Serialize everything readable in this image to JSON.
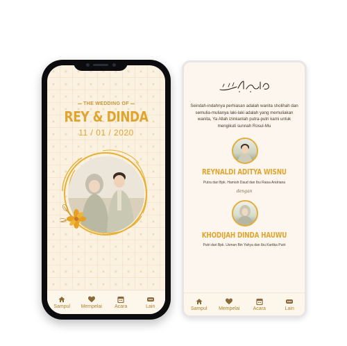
{
  "cover": {
    "subtitle": "THE WEDDING OF",
    "couple": "REY & DINDA",
    "date": "11 / 01 / 2020"
  },
  "nav_left": [
    {
      "label": "Sampul",
      "icon": "home-icon"
    },
    {
      "label": "Mempelai",
      "icon": "heart-icon"
    },
    {
      "label": "Acara",
      "icon": "calendar-icon"
    },
    {
      "label": "Lain",
      "icon": "more-icon"
    }
  ],
  "couple_page": {
    "quote": "Seindah-indahnya perhiasan adalah wanita sholihah dan semulia-mulianya laki-laki adalah yang memuliakan wanita, Ya Allah izinkanlah putra-putri kami untuk mengikuti sunnah Rosul-Mu",
    "groom_name": "REYNALDI ADITYA WISNU",
    "groom_parents": "Putra dari Bpk. Hamish Daud dan Ibu Raisa Andriana",
    "connector": "dengan",
    "bride_name": "KHODIJAH DINDA HAUWU",
    "bride_parents": "Putri dari Bpk. Usman Bin Yahya dan Ibu Kartika Putri"
  },
  "nav_right": [
    {
      "label": "Sampul",
      "icon": "home-icon"
    },
    {
      "label": "Mempelai",
      "icon": "heart-icon"
    },
    {
      "label": "Acara",
      "icon": "calendar-icon"
    },
    {
      "label": "Lain",
      "icon": "more-icon"
    }
  ],
  "colors": {
    "gold": "#e0a52f",
    "nav_icon": "#8a6a3a",
    "cream": "#fbf1e1",
    "phone_frame": "#0c0c0e"
  }
}
